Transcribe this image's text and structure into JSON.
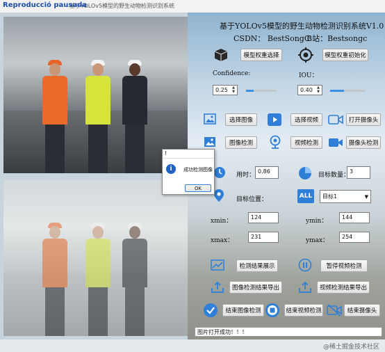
{
  "window": {
    "title": "基于YOLOv5模型的野生动物检测识别系统",
    "watermark": "Reproducció pausada"
  },
  "header": {
    "title": "基于YOLOv5模型的野生动物检测识别系统V1.0",
    "csdn": "CSDN： BestSongC",
    "bili": "B站：Bestsongc"
  },
  "model": {
    "select_label": "模型权重选择",
    "init_label": "模型权重初始化"
  },
  "params": {
    "confidence_label": "Confidence:",
    "confidence_value": "0.25",
    "confidence_level": 0.25,
    "iou_label": "IOU：",
    "iou_value": "0.40",
    "iou_level": 0.4
  },
  "buttons": {
    "select_image": "选择图像",
    "select_video": "选择视频",
    "open_camera": "打开摄像头",
    "image_detect": "图像检测",
    "video_detect": "视频检测",
    "camera_detect": "摄像头检测",
    "show_results": "检测结果展示",
    "pause_video": "暂停视频检测",
    "export_image": "图像检测结果导出",
    "export_video": "视频检测结果导出",
    "end_image": "结束图像检测",
    "end_video": "结束视频检测",
    "end_camera": "结束摄像头"
  },
  "stats": {
    "time_label": "用时：",
    "time_value": "0.86",
    "count_label": "目标数量：",
    "count_value": "3",
    "position_label": "目标位置：",
    "target_select": "目标1",
    "xmin_label": "xmin：",
    "xmin_value": "124",
    "ymin_label": "ymin：",
    "ymin_value": "144",
    "xmax_label": "xmax：",
    "xmax_value": "231",
    "ymax_label": "ymax：",
    "ymax_value": "254"
  },
  "dialog": {
    "title": "!",
    "message": "成功检测图像",
    "ok": "OK"
  },
  "status": "图片打开成功！！！",
  "footer": "@稀土掘金技术社区",
  "colors": {
    "accent": "#3b8ee6",
    "icon_blue": "#2f7fd9"
  }
}
